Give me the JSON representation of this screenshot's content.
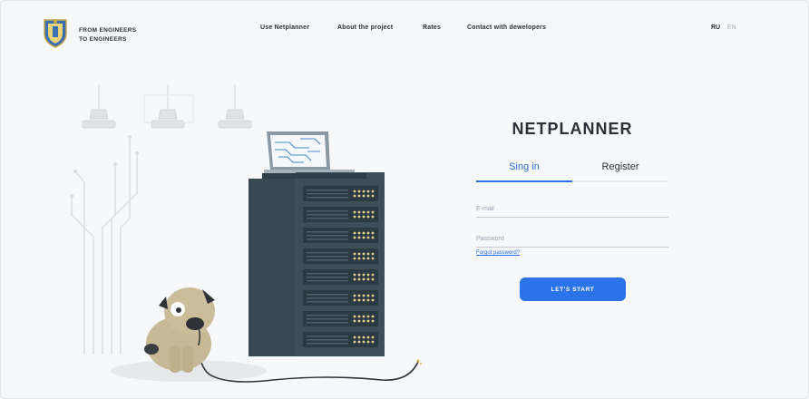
{
  "header": {
    "tagline_line1": "FROM ENGINEERS",
    "tagline_line2": "TO ENGINEERS",
    "nav": [
      {
        "label": "Use Netplanner"
      },
      {
        "label": "About the project"
      },
      {
        "label": "Rates"
      },
      {
        "label": "Contact with dewelopers"
      }
    ],
    "languages": {
      "ru": "RU",
      "en": "EN",
      "active": "RU"
    }
  },
  "form": {
    "title": "NETPLANNER",
    "tabs": {
      "signin": "Sing in",
      "register": "Register",
      "active": "signin"
    },
    "email": {
      "placeholder": "E-mail",
      "value": ""
    },
    "password": {
      "placeholder": "Password",
      "value": ""
    },
    "forgot_label": "Forgot password?",
    "submit_label": "LET'S START"
  },
  "colors": {
    "accent": "#2a73e8",
    "server": "#3a4a55",
    "dog": "#c7b896",
    "background": "#f7f8fa"
  }
}
